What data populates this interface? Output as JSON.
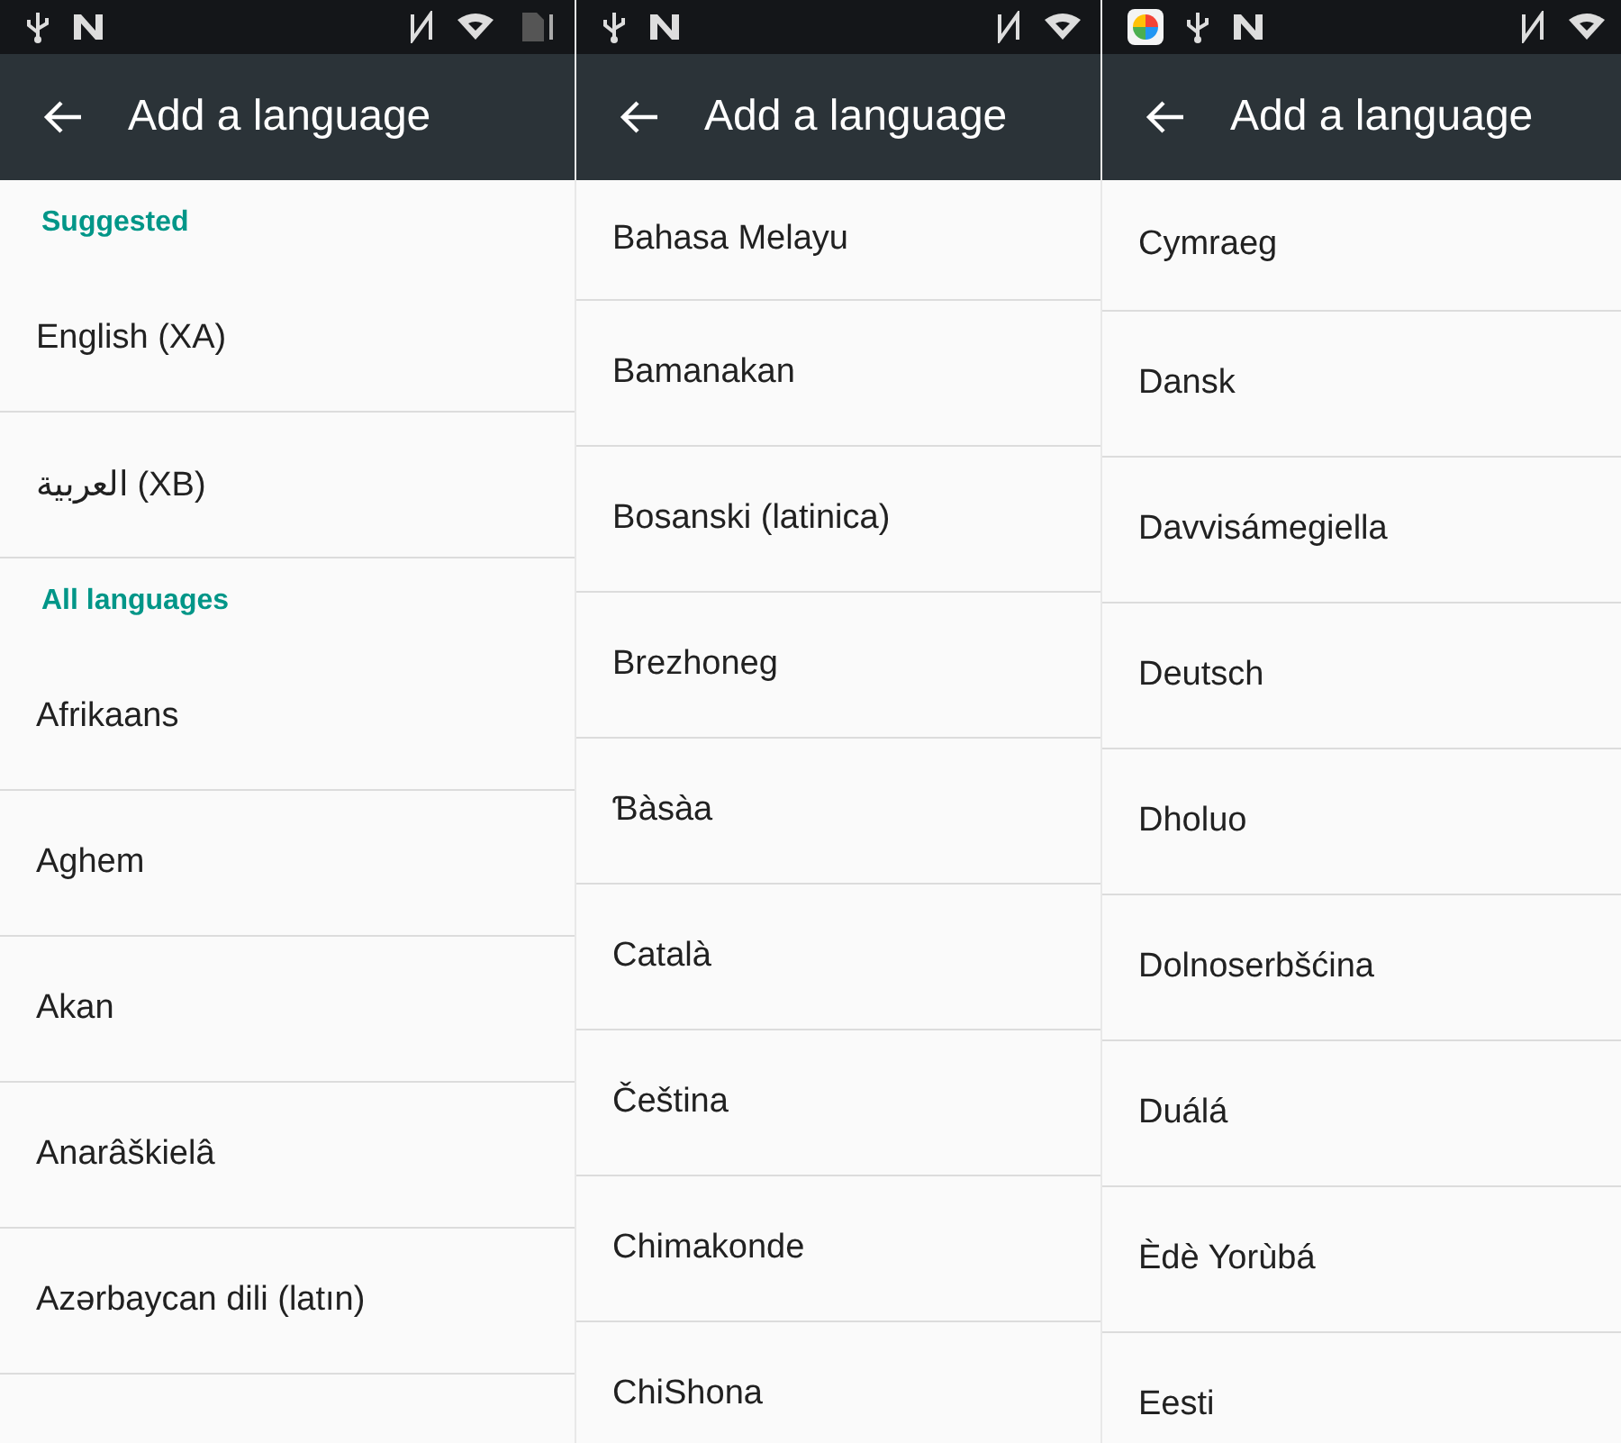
{
  "panels": [
    {
      "title": "Add a language",
      "items": [
        {
          "kind": "header",
          "text": "Suggested"
        },
        {
          "kind": "language",
          "text": "English (XA)"
        },
        {
          "kind": "language",
          "text": "العربية (XB)"
        },
        {
          "kind": "header",
          "text": "All languages"
        },
        {
          "kind": "language",
          "text": "Afrikaans"
        },
        {
          "kind": "language",
          "text": "Aghem"
        },
        {
          "kind": "language",
          "text": "Akan"
        },
        {
          "kind": "language",
          "text": "Anarâškielâ"
        },
        {
          "kind": "language",
          "text": "Azərbaycan dili (latın)"
        }
      ]
    },
    {
      "title": "Add a language",
      "items": [
        {
          "kind": "language",
          "text": "Bahasa Melayu"
        },
        {
          "kind": "language",
          "text": "Bamanakan"
        },
        {
          "kind": "language",
          "text": "Bosanski (latinica)"
        },
        {
          "kind": "language",
          "text": "Brezhoneg"
        },
        {
          "kind": "language",
          "text": "Ɓàsàa"
        },
        {
          "kind": "language",
          "text": "Català"
        },
        {
          "kind": "language",
          "text": "Čeština"
        },
        {
          "kind": "language",
          "text": "Chimakonde"
        },
        {
          "kind": "language",
          "text": "ChiShona"
        }
      ]
    },
    {
      "title": "Add a language",
      "items": [
        {
          "kind": "language",
          "text": "Cymraeg"
        },
        {
          "kind": "language",
          "text": "Dansk"
        },
        {
          "kind": "language",
          "text": "Davvisámegiella"
        },
        {
          "kind": "language",
          "text": "Deutsch"
        },
        {
          "kind": "language",
          "text": "Dholuo"
        },
        {
          "kind": "language",
          "text": "Dolnoserbšćina"
        },
        {
          "kind": "language",
          "text": "Duálá"
        },
        {
          "kind": "language",
          "text": "Èdè Yorùbá"
        },
        {
          "kind": "language",
          "text": "Eesti"
        }
      ]
    }
  ]
}
